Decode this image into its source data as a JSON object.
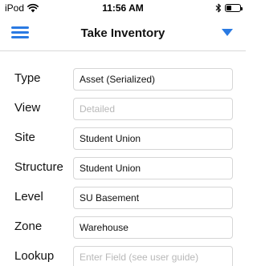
{
  "status_bar": {
    "device": "iPod",
    "time": "11:56 AM",
    "battery_level": 0.35
  },
  "nav": {
    "title": "Take Inventory",
    "menu_icon": "hamburger-menu-icon",
    "dropdown_icon": "triangle-down-icon",
    "accent_color": "#2a7ae2"
  },
  "form": {
    "rows": [
      {
        "label": "Type",
        "value": "Asset (Serialized)",
        "placeholder": ""
      },
      {
        "label": "View",
        "value": "",
        "placeholder": "Detailed"
      },
      {
        "label": "Site",
        "value": "Student Union",
        "placeholder": ""
      },
      {
        "label": "Structure",
        "value": "Student Union",
        "placeholder": ""
      },
      {
        "label": "Level",
        "value": "SU Basement",
        "placeholder": ""
      },
      {
        "label": "Zone",
        "value": "Warehouse",
        "placeholder": ""
      },
      {
        "label": "Lookup",
        "value": "",
        "placeholder": "Enter Field (see user guide)"
      }
    ]
  }
}
